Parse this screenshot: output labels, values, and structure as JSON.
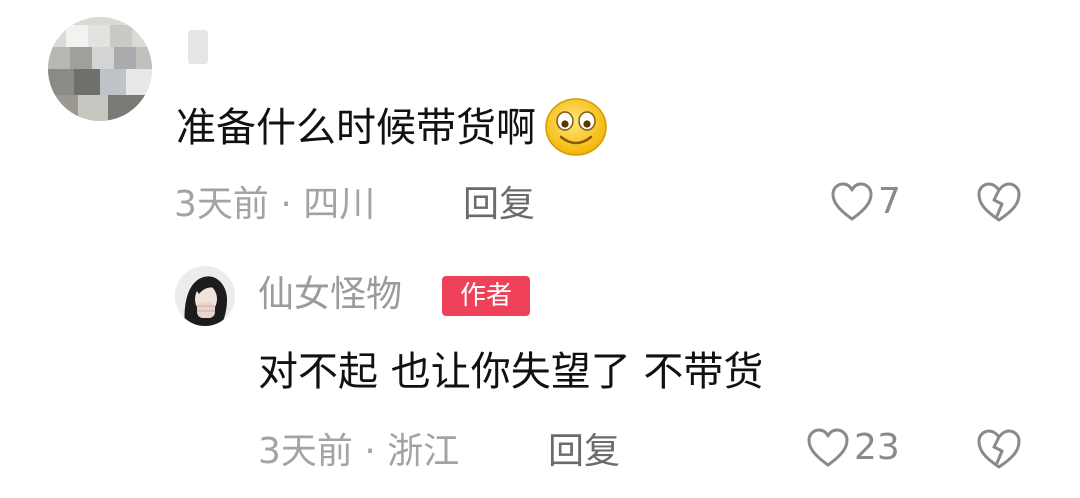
{
  "comments": [
    {
      "avatar_icon": "blurred-avatar",
      "content": "准备什么时候带货啊",
      "emoji_icon": "smile-emoji",
      "meta": "3天前 · 四川",
      "reply_label": "回复",
      "like_icon": "heart-outline-icon",
      "likes": "7",
      "dislike_icon": "broken-heart-icon"
    }
  ],
  "reply": {
    "avatar_icon": "profile-photo",
    "author": "仙女怪物",
    "author_badge": "作者",
    "content": "对不起 也让你失望了 不带货",
    "meta": "3天前 · 浙江",
    "reply_label": "回复",
    "like_icon": "heart-outline-icon",
    "likes": "23",
    "dislike_icon": "broken-heart-icon"
  },
  "colors": {
    "badge": "#f0415a",
    "meta_text": "#a3a3a3",
    "body_text": "#111111"
  }
}
